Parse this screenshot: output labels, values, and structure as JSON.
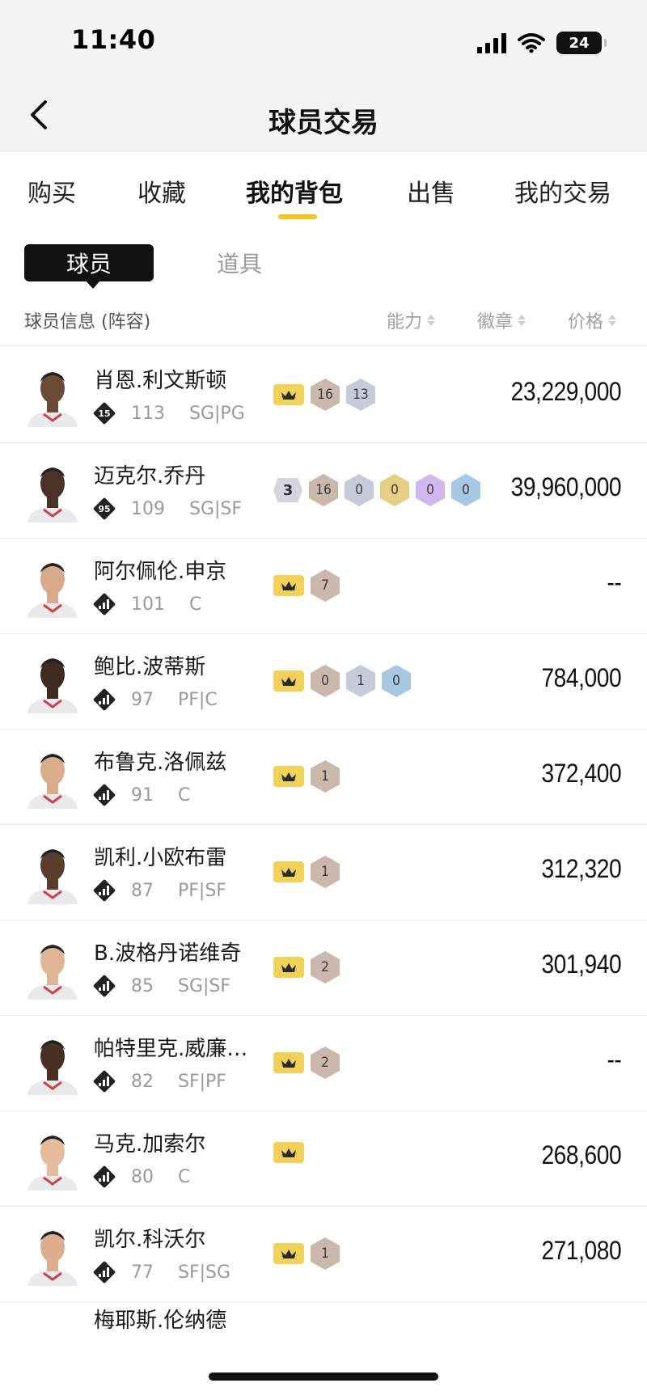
{
  "status_bar": {
    "time": "11:40",
    "battery": "24"
  },
  "nav": {
    "title": "球员交易",
    "back_icon": "chevron-left-icon"
  },
  "tabs": [
    {
      "label": "购买",
      "active": false
    },
    {
      "label": "收藏",
      "active": false
    },
    {
      "label": "我的背包",
      "active": true
    },
    {
      "label": "出售",
      "active": false
    },
    {
      "label": "我的交易",
      "active": false
    }
  ],
  "segment": {
    "players": "球员",
    "items": "道具"
  },
  "table_header": {
    "info": "球员信息 (阵容)",
    "ability": "能力",
    "badge": "徽章",
    "price": "价格"
  },
  "badge_colors": {
    "crown": "#f2d159",
    "bronze": "#c9b8ab",
    "silver": "#c7cbd9",
    "gold": "#e5cf86",
    "purple": "#d2b7ee",
    "blue": "#a8c7e3",
    "grade": "#d4d6df"
  },
  "players": [
    {
      "name": "肖恩.利文斯顿",
      "rank": "15",
      "rating": "113",
      "pos": "SG|PG",
      "price": "23,229,000",
      "badges": [
        {
          "t": "crown"
        },
        {
          "t": "bronze",
          "v": "16"
        },
        {
          "t": "silver",
          "v": "13"
        }
      ]
    },
    {
      "name": "迈克尔.乔丹",
      "rank": "95",
      "rating": "109",
      "pos": "SG|SF",
      "price": "39,960,000",
      "badges": [
        {
          "t": "grade",
          "v": "3"
        },
        {
          "t": "bronze",
          "v": "16"
        },
        {
          "t": "silver",
          "v": "0"
        },
        {
          "t": "gold",
          "v": "0"
        },
        {
          "t": "purple",
          "v": "0"
        },
        {
          "t": "blue",
          "v": "0"
        }
      ]
    },
    {
      "name": "阿尔佩伦.申京",
      "rank": "",
      "rating": "101",
      "pos": "C",
      "price": "--",
      "badges": [
        {
          "t": "crown"
        },
        {
          "t": "bronze",
          "v": "7"
        }
      ]
    },
    {
      "name": "鲍比.波蒂斯",
      "rank": "",
      "rating": "97",
      "pos": "PF|C",
      "price": "784,000",
      "badges": [
        {
          "t": "crown"
        },
        {
          "t": "bronze",
          "v": "0"
        },
        {
          "t": "silver",
          "v": "1"
        },
        {
          "t": "blue",
          "v": "0"
        }
      ]
    },
    {
      "name": "布鲁克.洛佩兹",
      "rank": "",
      "rating": "91",
      "pos": "C",
      "price": "372,400",
      "badges": [
        {
          "t": "crown"
        },
        {
          "t": "bronze",
          "v": "1"
        }
      ]
    },
    {
      "name": "凯利.小欧布雷",
      "rank": "",
      "rating": "87",
      "pos": "PF|SF",
      "price": "312,320",
      "badges": [
        {
          "t": "crown"
        },
        {
          "t": "bronze",
          "v": "1"
        }
      ]
    },
    {
      "name": "B.波格丹诺维奇",
      "rank": "",
      "rating": "85",
      "pos": "SG|SF",
      "price": "301,940",
      "badges": [
        {
          "t": "crown"
        },
        {
          "t": "bronze",
          "v": "2"
        }
      ]
    },
    {
      "name": "帕特里克.威廉…",
      "rank": "",
      "rating": "82",
      "pos": "SF|PF",
      "price": "--",
      "badges": [
        {
          "t": "crown"
        },
        {
          "t": "bronze",
          "v": "2"
        }
      ]
    },
    {
      "name": "马克.加索尔",
      "rank": "",
      "rating": "80",
      "pos": "C",
      "price": "268,600",
      "badges": [
        {
          "t": "crown"
        }
      ]
    },
    {
      "name": "凯尔.科沃尔",
      "rank": "",
      "rating": "77",
      "pos": "SF|SG",
      "price": "271,080",
      "badges": [
        {
          "t": "crown"
        },
        {
          "t": "bronze",
          "v": "1"
        }
      ]
    }
  ],
  "partial_player": {
    "name": "梅耶斯.伦纳德"
  }
}
